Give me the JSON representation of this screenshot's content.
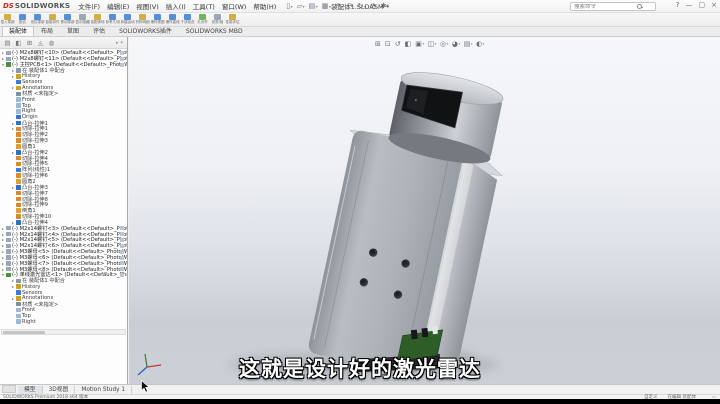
{
  "window": {
    "brand_mark": "DS",
    "brand_name": "SOLIDWORKS",
    "title": "装配体1.SLDASM *",
    "search_placeholder": "搜索命令",
    "help_label": "?",
    "minimize_label": "—",
    "restore_label": "▢",
    "close_label": "×"
  },
  "menus": [
    {
      "label": "文件(F)"
    },
    {
      "label": "编辑(E)"
    },
    {
      "label": "视图(V)"
    },
    {
      "label": "插入(I)"
    },
    {
      "label": "工具(T)"
    },
    {
      "label": "窗口(W)"
    },
    {
      "label": "帮助(H)"
    }
  ],
  "quick_access": [
    {
      "glyph": "▯",
      "caret": "▾",
      "icon": "new-file-icon"
    },
    {
      "glyph": "▱",
      "caret": "▾",
      "icon": "open-file-icon"
    },
    {
      "glyph": "▤",
      "caret": "▾",
      "icon": "save-icon"
    },
    {
      "glyph": "▦",
      "caret": "▾",
      "icon": "print-icon"
    },
    {
      "glyph": "↶",
      "caret": "▾",
      "icon": "undo-icon"
    },
    {
      "glyph": "↷",
      "caret": "",
      "icon": "redo-icon"
    },
    {
      "glyph": "↻",
      "caret": "▾",
      "icon": "rebuild-icon"
    },
    {
      "glyph": "◔",
      "caret": "",
      "icon": "appearance-icon"
    },
    {
      "glyph": "✱",
      "caret": "▾",
      "icon": "options-gear-icon"
    }
  ],
  "ribbon": {
    "buttons": [
      {
        "label": "插入零部件",
        "icon_color": "#c9a227"
      },
      {
        "label": "配合",
        "icon_color": "#3a7bd5"
      },
      {
        "label": "线性零部件阵列",
        "icon_color": "#3a7bd5"
      },
      {
        "label": "智能扣件",
        "icon_color": "#c9a227"
      },
      {
        "label": "移动零部件",
        "icon_color": "#3a7bd5"
      },
      {
        "label": "显示隐藏的零部件",
        "icon_color": "#8d99a6"
      },
      {
        "label": "装配体特征",
        "icon_color": "#c9a227"
      },
      {
        "label": "参考几何图形",
        "icon_color": "#3a7bd5"
      },
      {
        "label": "新建运动算例",
        "icon_color": "#3a7bd5"
      },
      {
        "label": "材料明细表",
        "icon_color": "#c9a227"
      },
      {
        "label": "爆炸视图",
        "icon_color": "#3a7bd5"
      },
      {
        "label": "爆炸直线草图",
        "icon_color": "#3a7bd5"
      },
      {
        "label": "干涉检查",
        "icon_color": "#3a7bd5"
      },
      {
        "label": "孔对齐",
        "icon_color": "#58a843"
      },
      {
        "label": "皮带/链",
        "icon_color": "#8d99a6"
      },
      {
        "label": "性能评估",
        "icon_color": "#c9a227"
      }
    ]
  },
  "command_tabs": [
    {
      "label": "装配体",
      "cls": "active"
    },
    {
      "label": "布局"
    },
    {
      "label": "草图"
    },
    {
      "label": "评估"
    },
    {
      "label": "SOLIDWORKS插件"
    },
    {
      "label": "SOLIDWORKS MBD"
    }
  ],
  "panel_tabs": [
    {
      "glyph": "▤",
      "icon": "featuremanager-tree-tab-icon"
    },
    {
      "glyph": "◧",
      "icon": "propertymanager-tab-icon"
    },
    {
      "glyph": "⊞",
      "icon": "configuration-manager-tab-icon"
    },
    {
      "glyph": "◬",
      "icon": "dimxpert-tab-icon"
    },
    {
      "glyph": "◍",
      "icon": "displaymanager-tab-icon"
    }
  ],
  "panel_header_right": {
    "arrow": "▸",
    "pin": "▾"
  },
  "feature_tree": {
    "rows": [
      {
        "cls": "comp",
        "expander": "▸",
        "icon_color": "#9aa5b8",
        "label": "(-) M2x8螺钉<10> (Default<<Default>_PhotoWorks"
      },
      {
        "cls": "comp",
        "expander": "▸",
        "icon_color": "#9aa5b8",
        "label": "(-) M2x8螺钉<11> (Default<<Default>_PhotoWorks"
      },
      {
        "cls": "comp",
        "expander": "▾",
        "icon_color": "#4a8f3f",
        "label": "(-) 主控PCB<1> (Default<<Default>_PhotoWork"
      },
      {
        "cls": "ind1",
        "expander": "▸",
        "icon_color": "#8a98a8",
        "label": "在 装配体1 中配合"
      },
      {
        "cls": "ind1",
        "expander": "▸",
        "icon_color": "#c9a227",
        "label": "History"
      },
      {
        "cls": "ind1",
        "expander": "",
        "icon_color": "#3a7bd5",
        "label": "Sensors"
      },
      {
        "cls": "ind1",
        "expander": "▸",
        "icon_color": "#c9a227",
        "label": "Annotations"
      },
      {
        "cls": "ind1",
        "expander": "",
        "icon_color": "#7f8fa0",
        "label": "材质 <未指定>"
      },
      {
        "cls": "ind1",
        "expander": "",
        "icon_color": "#9db8d9",
        "label": "Front"
      },
      {
        "cls": "ind1",
        "expander": "",
        "icon_color": "#9db8d9",
        "label": "Top"
      },
      {
        "cls": "ind1",
        "expander": "",
        "icon_color": "#9db8d9",
        "label": "Right"
      },
      {
        "cls": "ind1",
        "expander": "",
        "icon_color": "#3a6fd8",
        "label": "Origin"
      },
      {
        "cls": "ind1",
        "expander": "▸",
        "icon_color": "#2f6fc4",
        "label": "凸台-拉伸1"
      },
      {
        "cls": "ind1",
        "expander": "▸",
        "icon_color": "#d98a2f",
        "label": "切除-拉伸1"
      },
      {
        "cls": "ind1",
        "expander": "",
        "icon_color": "#d98a2f",
        "label": "切除-拉伸2"
      },
      {
        "cls": "ind1",
        "expander": "",
        "icon_color": "#d98a2f",
        "label": "切除-拉伸3"
      },
      {
        "cls": "ind1",
        "expander": "",
        "icon_color": "#e0a030",
        "label": "圆角1"
      },
      {
        "cls": "ind1",
        "expander": "▸",
        "icon_color": "#2f6fc4",
        "label": "凸台-拉伸2"
      },
      {
        "cls": "ind1",
        "expander": "",
        "icon_color": "#d98a2f",
        "label": "切除-拉伸4"
      },
      {
        "cls": "ind1",
        "expander": "",
        "icon_color": "#d98a2f",
        "label": "切除-拉伸5"
      },
      {
        "cls": "ind1",
        "expander": "",
        "icon_color": "#3a7bd5",
        "label": "阵列(线性)1"
      },
      {
        "cls": "ind1",
        "expander": "",
        "icon_color": "#d98a2f",
        "label": "切除-拉伸6"
      },
      {
        "cls": "ind1",
        "expander": "",
        "icon_color": "#e0a030",
        "label": "圆角2"
      },
      {
        "cls": "ind1",
        "expander": "▸",
        "icon_color": "#2f6fc4",
        "label": "凸台-拉伸3"
      },
      {
        "cls": "ind1",
        "expander": "",
        "icon_color": "#d98a2f",
        "label": "切除-拉伸7"
      },
      {
        "cls": "ind1",
        "expander": "",
        "icon_color": "#d98a2f",
        "label": "切除-拉伸8"
      },
      {
        "cls": "ind1",
        "expander": "",
        "icon_color": "#d98a2f",
        "label": "切除-拉伸9"
      },
      {
        "cls": "ind1",
        "expander": "",
        "icon_color": "#e0a030",
        "label": "倒角1"
      },
      {
        "cls": "ind1",
        "expander": "",
        "icon_color": "#d98a2f",
        "label": "切除-拉伸10"
      },
      {
        "cls": "ind1",
        "expander": "▸",
        "icon_color": "#2f6fc4",
        "label": "凸台-拉伸4"
      },
      {
        "cls": "comp",
        "expander": "▸",
        "icon_color": "#9aa5b8",
        "label": "(-) M2x14螺钉<3> (Default<<Default>_PhotoWorks Di"
      },
      {
        "cls": "comp",
        "expander": "▸",
        "icon_color": "#9aa5b8",
        "label": "(-) M2x14螺钉<4> (Default<<Default>_PhotoWorks Di"
      },
      {
        "cls": "comp",
        "expander": "▸",
        "icon_color": "#9aa5b8",
        "label": "(-) M2x14螺钉<5> (Default<<Default>_PhotoWorks Di"
      },
      {
        "cls": "comp",
        "expander": "▸",
        "icon_color": "#9aa5b8",
        "label": "(-) M2x14螺钉<6> (Default<<Default>_PhotoWorks Di"
      },
      {
        "cls": "comp",
        "expander": "▸",
        "icon_color": "#9aa5b8",
        "label": "(-) M3螺母<5> (Default<<Default>_PhotoWorks Dis"
      },
      {
        "cls": "comp",
        "expander": "▸",
        "icon_color": "#9aa5b8",
        "label": "(-) M3螺母<6> (Default<<Default>_PhotoWorks Dis"
      },
      {
        "cls": "comp",
        "expander": "▸",
        "icon_color": "#9aa5b8",
        "label": "(-) M3螺母<7> (Default<<Default>_PhotoWorks Dis"
      },
      {
        "cls": "comp",
        "expander": "▸",
        "icon_color": "#9aa5b8",
        "label": "(-) M3螺母<8> (Default<<Default>_PhotoWorks Dis"
      },
      {
        "cls": "comp",
        "expander": "▾",
        "icon_color": "#4a8f3f",
        "label": "(-) 单线激光雷达<1> (Default<<Default>_PhotoWorks"
      },
      {
        "cls": "ind1",
        "expander": "▸",
        "icon_color": "#8a98a8",
        "label": "在 装配体1 中配合"
      },
      {
        "cls": "ind1",
        "expander": "▸",
        "icon_color": "#c9a227",
        "label": "History"
      },
      {
        "cls": "ind1",
        "expander": "",
        "icon_color": "#3a7bd5",
        "label": "Sensors"
      },
      {
        "cls": "ind1",
        "expander": "▸",
        "icon_color": "#c9a227",
        "label": "Annotations"
      },
      {
        "cls": "ind1",
        "expander": "",
        "icon_color": "#7f8fa0",
        "label": "材质 <未指定>"
      },
      {
        "cls": "ind1",
        "expander": "",
        "icon_color": "#9db8d9",
        "label": "Front"
      },
      {
        "cls": "ind1",
        "expander": "",
        "icon_color": "#9db8d9",
        "label": "Top"
      },
      {
        "cls": "ind1",
        "expander": "",
        "icon_color": "#9db8d9",
        "label": "Right"
      }
    ]
  },
  "heads_up": [
    {
      "glyph": "⊞",
      "caret": "",
      "icon": "zoom-to-fit-icon"
    },
    {
      "glyph": "⊡",
      "caret": "",
      "icon": "zoom-to-area-icon"
    },
    {
      "glyph": "↺",
      "caret": "",
      "icon": "previous-view-icon"
    },
    {
      "glyph": "◧",
      "caret": "",
      "icon": "section-view-icon"
    },
    {
      "glyph": "▣",
      "caret": "▾",
      "icon": "view-orientation-icon"
    },
    {
      "glyph": "◫",
      "caret": "▾",
      "icon": "display-style-icon"
    },
    {
      "glyph": "◎",
      "caret": "▾",
      "icon": "hide-show-items-icon"
    },
    {
      "glyph": "◕",
      "caret": "▾",
      "icon": "edit-appearance-icon"
    },
    {
      "glyph": "▤",
      "caret": "▾",
      "icon": "apply-scene-icon"
    },
    {
      "glyph": "◐",
      "caret": "▾",
      "icon": "view-settings-icon"
    }
  ],
  "viewport": {
    "subtitle": "这就是设计好的激光雷达"
  },
  "motion_bar": {
    "tabs": [
      {
        "label": "模型",
        "cls": "active"
      },
      {
        "label": "3D视图"
      },
      {
        "label": "Motion Study 1"
      }
    ]
  },
  "status_bar": {
    "left": "SOLIDWORKS Premium 2018 x64 版本",
    "unit_mode": "自定义",
    "edit_state": "在编辑 装配体",
    "corner_glyph": "▭"
  },
  "colors": {
    "brand_red": "#d1271f",
    "viewport_top": "#f6f7fa",
    "viewport_bottom": "#ccd0d6",
    "model_gray": "#a7acb3",
    "lidar_window_black": "#101214",
    "pcb_green": "#2f5d28",
    "subtitle_text": "#ffffff",
    "subtitle_outline": "#000000"
  }
}
